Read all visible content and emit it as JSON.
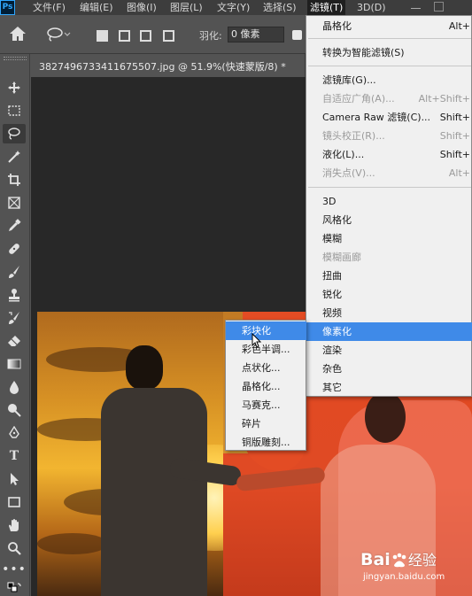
{
  "menubar": {
    "logo": "Ps",
    "items": [
      "文件(F)",
      "编辑(E)",
      "图像(I)",
      "图层(L)",
      "文字(Y)",
      "选择(S)",
      "滤镜(T)",
      "3D(D)"
    ],
    "active_index": 6
  },
  "options_bar": {
    "feather_label": "羽化:",
    "feather_value": "0 像素"
  },
  "document": {
    "tab_title": "3827496733411675507.jpg @ 51.9%(快速蒙版/8) *",
    "close_symbol": "×"
  },
  "tools": [
    {
      "icon": "home-icon"
    },
    {
      "icon": "move-tool-icon"
    },
    {
      "icon": "marquee-tool-icon"
    },
    {
      "icon": "lasso-tool-icon"
    },
    {
      "icon": "magic-wand-icon"
    },
    {
      "icon": "crop-tool-icon"
    },
    {
      "icon": "frame-tool-icon"
    },
    {
      "icon": "eyedropper-icon"
    },
    {
      "icon": "healing-brush-icon"
    },
    {
      "icon": "brush-tool-icon"
    },
    {
      "icon": "clone-stamp-icon"
    },
    {
      "icon": "history-brush-icon"
    },
    {
      "icon": "eraser-icon"
    },
    {
      "icon": "gradient-tool-icon"
    },
    {
      "icon": "blur-tool-icon"
    },
    {
      "icon": "dodge-tool-icon"
    },
    {
      "icon": "pen-tool-icon"
    },
    {
      "icon": "type-tool-icon"
    },
    {
      "icon": "path-selection-icon"
    },
    {
      "icon": "rectangle-tool-icon"
    },
    {
      "icon": "hand-tool-icon"
    },
    {
      "icon": "zoom-tool-icon"
    },
    {
      "icon": "more-tools-icon"
    }
  ],
  "filter_menu": {
    "items": [
      {
        "label": "晶格化",
        "shortcut": "Alt+"
      },
      {
        "label": "转换为智能滤镜(S)",
        "shortcut": ""
      },
      {
        "label": "滤镜库(G)...",
        "shortcut": ""
      },
      {
        "label": "自适应广角(A)...",
        "shortcut": "Alt+Shift+"
      },
      {
        "label": "Camera Raw 滤镜(C)...",
        "shortcut": "Shift+"
      },
      {
        "label": "镜头校正(R)...",
        "shortcut": "Shift+"
      },
      {
        "label": "液化(L)...",
        "shortcut": "Shift+"
      },
      {
        "label": "消失点(V)...",
        "shortcut": "Alt+"
      },
      {
        "label": "3D",
        "shortcut": ""
      },
      {
        "label": "风格化",
        "shortcut": ""
      },
      {
        "label": "模糊",
        "shortcut": ""
      },
      {
        "label": "模糊画廊",
        "shortcut": ""
      },
      {
        "label": "扭曲",
        "shortcut": ""
      },
      {
        "label": "锐化",
        "shortcut": ""
      },
      {
        "label": "视频",
        "shortcut": ""
      },
      {
        "label": "像素化",
        "shortcut": ""
      },
      {
        "label": "渲染",
        "shortcut": ""
      },
      {
        "label": "杂色",
        "shortcut": ""
      },
      {
        "label": "其它",
        "shortcut": ""
      }
    ]
  },
  "pixelate_submenu": {
    "items": [
      "彩块化",
      "彩色半调...",
      "点状化...",
      "晶格化...",
      "马赛克...",
      "碎片",
      "铜版雕刻..."
    ]
  },
  "watermark": {
    "brand": "Bai",
    "brand_suffix": "经验",
    "url": "jingyan.baidu.com"
  },
  "colors": {
    "highlight": "#3f8ae8",
    "menu_bg": "#f0f0f0",
    "ui_dark": "#535353"
  }
}
